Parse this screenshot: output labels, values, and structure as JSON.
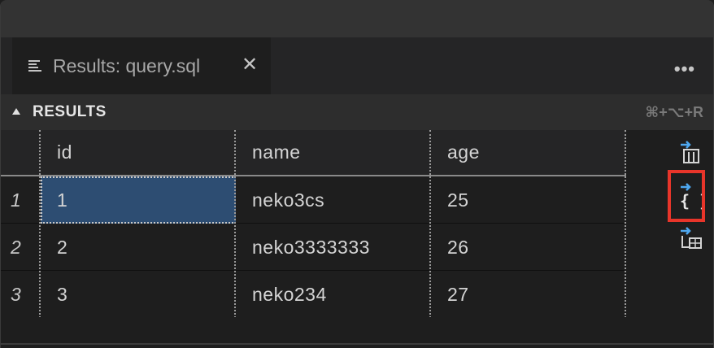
{
  "tab": {
    "label": "Results: query.sql",
    "close_glyph": "✕",
    "icon": "list-icon"
  },
  "more_actions": "•••",
  "panel": {
    "title": "RESULTS",
    "shortcut": "⌘+⌥+R"
  },
  "table": {
    "columns": [
      "id",
      "name",
      "age"
    ],
    "rows": [
      {
        "num": "1",
        "id": "1",
        "name": "neko3cs",
        "age": "25"
      },
      {
        "num": "2",
        "id": "2",
        "name": "neko3333333",
        "age": "26"
      },
      {
        "num": "3",
        "id": "3",
        "name": "neko234",
        "age": "27"
      }
    ],
    "selected_cell": "row 1, column id"
  },
  "side_actions": [
    {
      "name": "save-as-csv-icon"
    },
    {
      "name": "save-as-json-icon",
      "glyph": "{ }"
    },
    {
      "name": "save-as-excel-icon"
    }
  ],
  "colors": {
    "accent_blue": "#4ea8f0",
    "selection": "#2d4d72",
    "highlight_box": "#e8352a"
  }
}
